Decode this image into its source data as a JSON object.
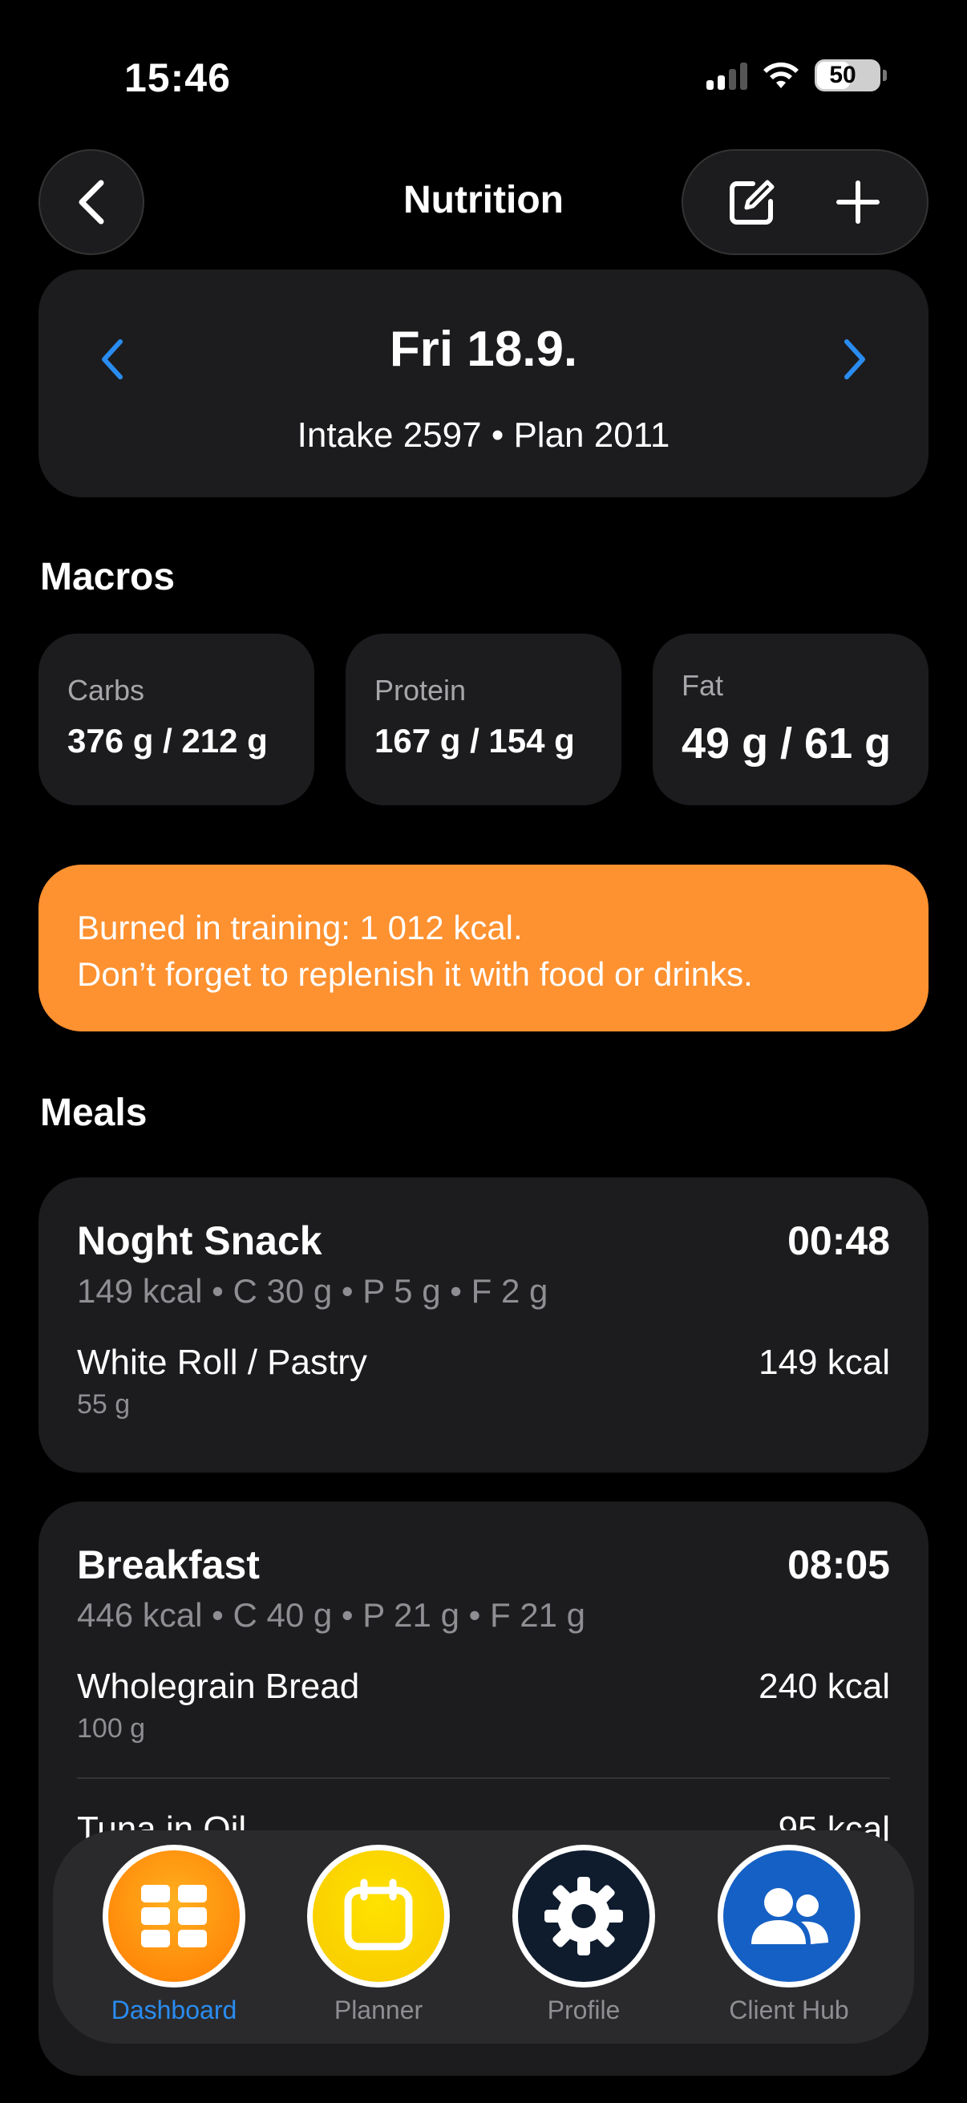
{
  "status": {
    "time": "15:46",
    "battery": "50"
  },
  "nav": {
    "title": "Nutrition",
    "back_icon": "chevron-left-icon",
    "edit_icon": "edit-icon",
    "add_icon": "plus-icon"
  },
  "date_card": {
    "title": "Fri 18.9.",
    "subtitle": "Intake 2597 • Plan 2011",
    "arrow_color": "#2a8cf0"
  },
  "macros": {
    "title": "Macros",
    "items": [
      {
        "label": "Carbs",
        "value": "376 g / 212 g"
      },
      {
        "label": "Protein",
        "value": "167 g / 154 g"
      },
      {
        "label": "Fat",
        "value": "49 g / 61 g"
      }
    ]
  },
  "banner": {
    "line1": "Burned in training: 1 012 kcal.",
    "line2": "Don’t forget to replenish it with food or drinks.",
    "color": "#fe9130"
  },
  "meals": {
    "title": "Meals",
    "items": [
      {
        "name": "Noght Snack",
        "time": "00:48",
        "summary": "149 kcal • C 30 g • P 5 g • F 2 g",
        "foods": [
          {
            "name": "White Roll / Pastry",
            "weight": "55 g",
            "kcal": "149 kcal"
          }
        ]
      },
      {
        "name": "Breakfast",
        "time": "08:05",
        "summary": "446 kcal • C 40 g • P 21 g • F 21 g",
        "foods": [
          {
            "name": "Wholegrain Bread",
            "weight": "100 g",
            "kcal": "240 kcal"
          },
          {
            "name": "Tuna in Oil",
            "weight": "",
            "kcal": "95 kcal"
          }
        ]
      }
    ]
  },
  "tabbar": {
    "tabs": [
      {
        "label": "Dashboard",
        "icon": "grid-icon",
        "active": true
      },
      {
        "label": "Planner",
        "icon": "calendar-icon",
        "active": false
      },
      {
        "label": "Profile",
        "icon": "gear-icon",
        "active": false
      },
      {
        "label": "Client Hub",
        "icon": "users-icon",
        "active": false
      }
    ]
  }
}
